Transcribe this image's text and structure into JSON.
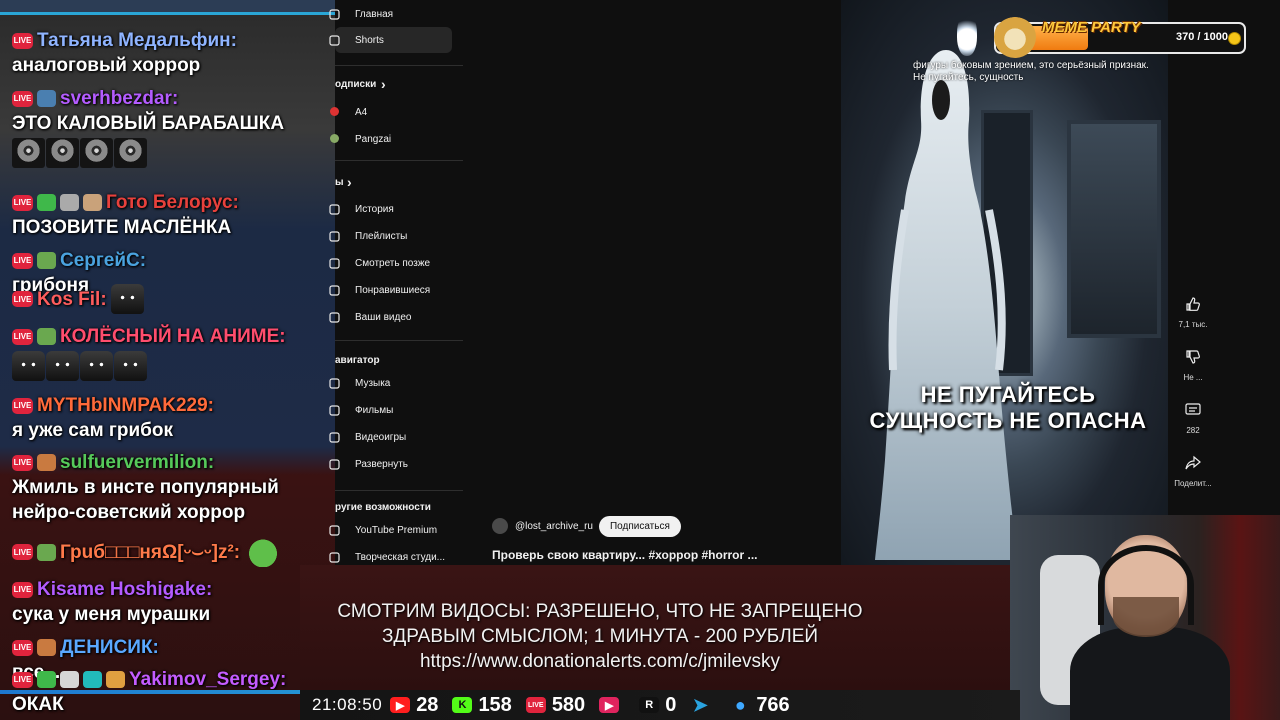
{
  "chat": {
    "messages": [
      {
        "nick": "Татьяна Медальфин:",
        "nick_color": "#8fb4ff",
        "text": "аналоговый хоррор",
        "emotes": 0
      },
      {
        "nick": "sverhbezdar:",
        "nick_color": "#b45cff",
        "text": "ЭТО КАЛОВЫЙ БАРАБАШКА",
        "emotes": 4
      },
      {
        "nick": "Гото Белорус:",
        "nick_color": "#e8413c",
        "text": "ПОЗОВИТЕ МАСЛЁНКА",
        "emotes": 0
      },
      {
        "nick": "СергейС:",
        "nick_color": "#4aa3df",
        "text": "грибоня",
        "emotes": 0
      },
      {
        "nick": "Kos Fil:",
        "nick_color": "#ff5d5d",
        "text": "",
        "emotes": 1
      },
      {
        "nick": "КОЛЁСНЫЙ НА АНИМЕ:",
        "nick_color": "#ff4d6d",
        "text": "",
        "emotes": 4
      },
      {
        "nick": "МYTHbINМPAK229:",
        "nick_color": "#ff6a3a",
        "text": "я уже сам грибок",
        "emotes": 0
      },
      {
        "nick": "sulfuervermilion:",
        "nick_color": "#56c95a",
        "text": "Жмиль в инсте популярный нейро-советский хоррор",
        "emotes": 0
      },
      {
        "nick": "Грuб□□□няΩ[ᵕ⌣ᵕ]z²:",
        "nick_color": "#ff7a4a",
        "text": "",
        "emotes": 1
      },
      {
        "nick": "Kisame Hoshigake:",
        "nick_color": "#b45cff",
        "text": "сука у меня мурашки",
        "emotes": 0
      },
      {
        "nick": "ДЕНИСИК:",
        "nick_color": "#5aa8ff",
        "text": "все...",
        "emotes": 0
      },
      {
        "nick": "Yakimov_Sergey:",
        "nick_color": "#c45cff",
        "text": "ОКАК",
        "emotes": 0
      }
    ],
    "live_label": "LIVE"
  },
  "sidebar": {
    "items_top": [
      {
        "label": "Главная",
        "icon": "home-icon"
      },
      {
        "label": "Shorts",
        "icon": "shorts-icon",
        "active": true
      }
    ],
    "subs_heading": "одписки",
    "channels": [
      {
        "label": "A4",
        "color": "#d33"
      },
      {
        "label": "Pangzai",
        "color": "#8a6"
      }
    ],
    "you_heading": "ы",
    "items_you": [
      {
        "label": "История",
        "icon": "history-icon"
      },
      {
        "label": "Плейлисты",
        "icon": "playlists-icon"
      },
      {
        "label": "Смотреть позже",
        "icon": "watch-later-icon"
      },
      {
        "label": "Понравившиеся",
        "icon": "liked-icon"
      },
      {
        "label": "Ваши видео",
        "icon": "your-videos-icon"
      }
    ],
    "nav_heading": "авигатор",
    "items_nav": [
      {
        "label": "Музыка",
        "icon": "music-icon"
      },
      {
        "label": "Фильмы",
        "icon": "movies-icon"
      },
      {
        "label": "Видеоигры",
        "icon": "gaming-icon"
      },
      {
        "label": "Развернуть",
        "icon": "expand-icon"
      }
    ],
    "more_heading": "ругие возможности",
    "items_more": [
      {
        "label": "YouTube Premium",
        "icon": "youtube-premium-icon"
      },
      {
        "label": "Творческая студи...",
        "icon": "studio-icon"
      }
    ]
  },
  "short": {
    "caption": "фигуры боковым зрением, это серьёзный признак. Не пугайтесь, сущность",
    "headline_line1": "НЕ ПУГАЙТЕСЬ",
    "headline_line2": "СУЩНОСТЬ НЕ ОПАСНА",
    "channel": "@lost_archive_ru",
    "subscribe_label": "Подписаться",
    "title": "Проверь свою квартиру... #хоррор #horror ...",
    "actions": [
      {
        "name": "like",
        "icon": "thumbs-up-icon",
        "count": "7,1 тыс."
      },
      {
        "name": "dislike",
        "icon": "thumbs-down-icon",
        "count": "Не ..."
      },
      {
        "name": "comments",
        "icon": "comment-icon",
        "count": "282"
      },
      {
        "name": "share",
        "icon": "share-icon",
        "count": "Поделит..."
      }
    ]
  },
  "meme_party": {
    "title": "MEME PARTY",
    "progress_text": "370 / 1000",
    "progress": 0.37
  },
  "donation": {
    "line1": "СМОТРИМ ВИДОСЫ: РАЗРЕШЕНО, ЧТО НЕ ЗАПРЕЩЕНО",
    "line2": "ЗДРАВЫМ СМЫСЛОМ; 1 МИНУТА - 200 РУБЛЕЙ",
    "line3": "https://www.donationalerts.com/c/jmilevsky"
  },
  "stats": {
    "clock": "21:08:50",
    "items": [
      {
        "icon": "youtube-icon",
        "value": "28",
        "color": "#ff1e1e",
        "glyph": "▶"
      },
      {
        "icon": "kick-icon",
        "value": "158",
        "color": "#53fc18",
        "glyph": "K"
      },
      {
        "icon": "vk-live-icon",
        "value": "580",
        "color": "#e0243d",
        "glyph": "LIVE"
      },
      {
        "icon": "rutube-play-icon",
        "value": "",
        "color": "#e0245e",
        "glyph": "▶"
      },
      {
        "icon": "rutube-icon",
        "value": "0",
        "color": "#111",
        "glyph": "R"
      },
      {
        "icon": "telegram-icon",
        "value": "",
        "color": "#2aa3df",
        "glyph": "➤"
      },
      {
        "icon": "viewers-icon",
        "value": "766",
        "color": "#3ea8ff",
        "glyph": "●"
      }
    ]
  }
}
